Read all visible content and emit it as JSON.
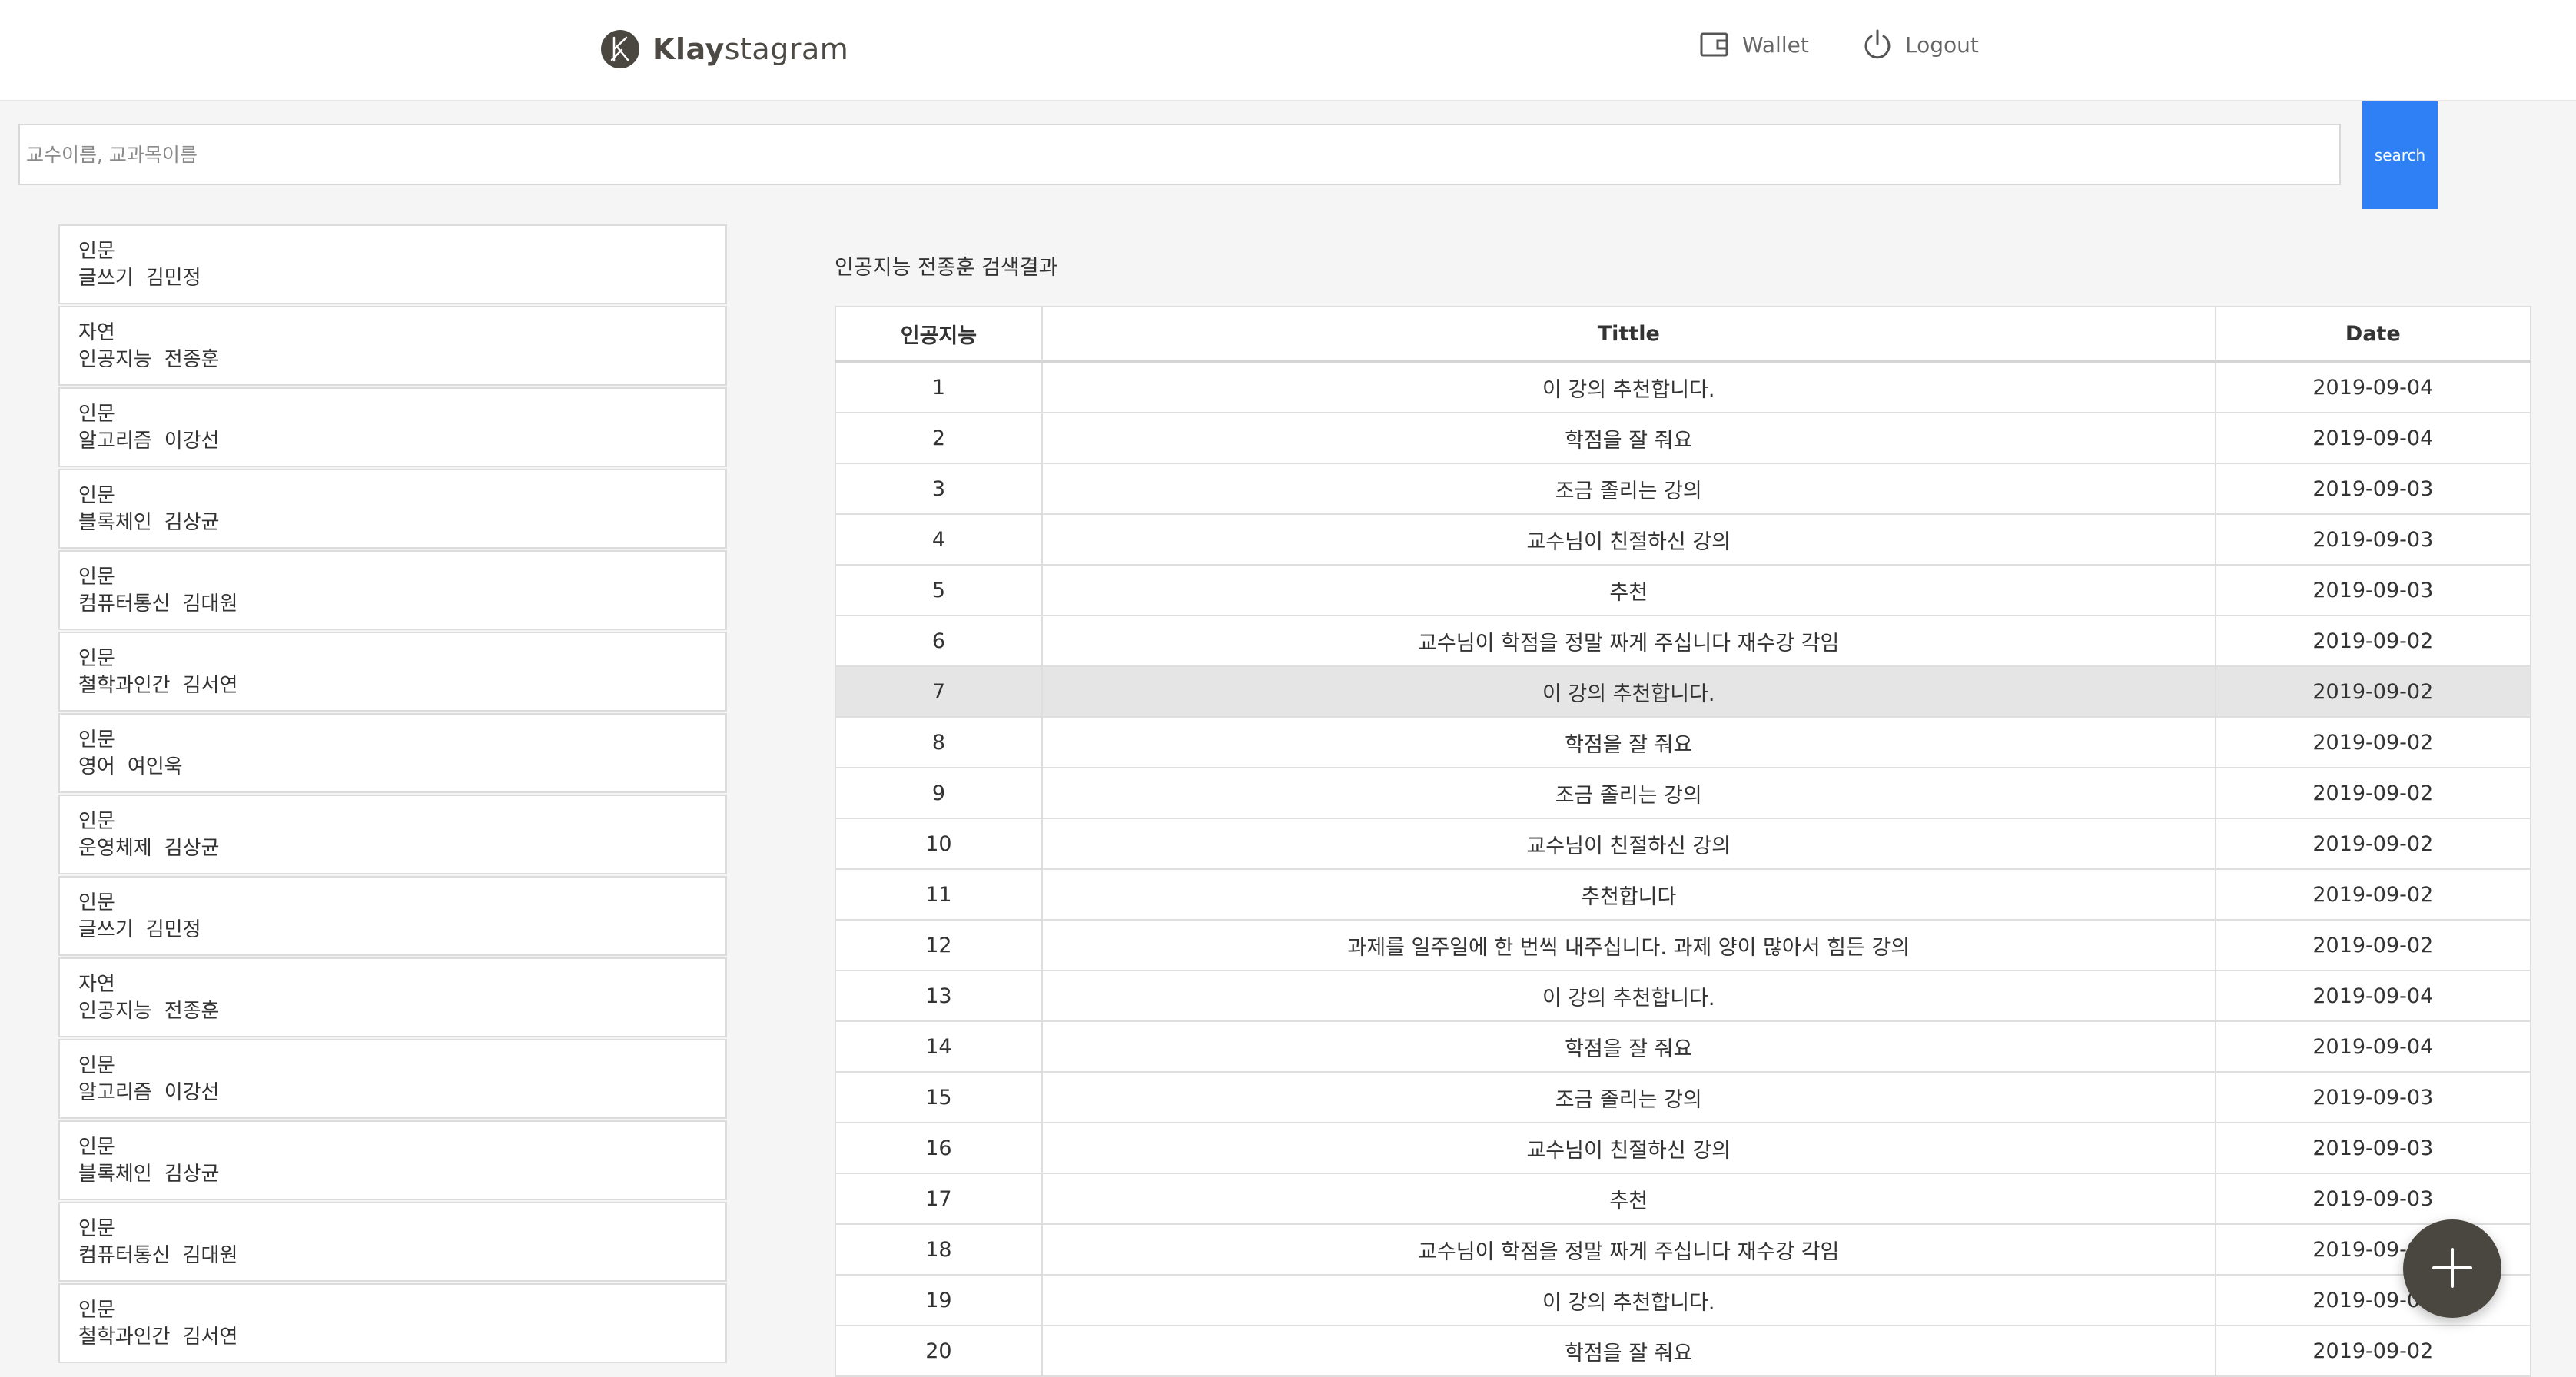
{
  "header": {
    "logo_bold": "Klay",
    "logo_rest": "stagram",
    "wallet_label": "Wallet",
    "logout_label": "Logout"
  },
  "search": {
    "placeholder": "교수이름, 교과목이름",
    "value": "",
    "button_label": "search"
  },
  "courses": [
    {
      "category": "인문",
      "course": "글쓰기",
      "professor": "김민정"
    },
    {
      "category": "자연",
      "course": "인공지능",
      "professor": "전종훈"
    },
    {
      "category": "인문",
      "course": "알고리즘",
      "professor": "이강선"
    },
    {
      "category": "인문",
      "course": "블록체인",
      "professor": "김상균"
    },
    {
      "category": "인문",
      "course": "컴퓨터통신",
      "professor": "김대원"
    },
    {
      "category": "인문",
      "course": "철학과인간",
      "professor": "김서연"
    },
    {
      "category": "인문",
      "course": "영어",
      "professor": "여인욱"
    },
    {
      "category": "인문",
      "course": "운영체제",
      "professor": "김상균"
    },
    {
      "category": "인문",
      "course": "글쓰기",
      "professor": "김민정"
    },
    {
      "category": "자연",
      "course": "인공지능",
      "professor": "전종훈"
    },
    {
      "category": "인문",
      "course": "알고리즘",
      "professor": "이강선"
    },
    {
      "category": "인문",
      "course": "블록체인",
      "professor": "김상균"
    },
    {
      "category": "인문",
      "course": "컴퓨터통신",
      "professor": "김대원"
    },
    {
      "category": "인문",
      "course": "철학과인간",
      "professor": "김서연"
    }
  ],
  "results": {
    "title": "인공지능 전종훈 검색결과",
    "headers": {
      "no": "인공지능",
      "title": "Tittle",
      "date": "Date"
    },
    "highlighted_row": 7,
    "rows": [
      {
        "no": "1",
        "title": "이 강의 추천합니다.",
        "date": "2019-09-04"
      },
      {
        "no": "2",
        "title": "학점을 잘 줘요",
        "date": "2019-09-04"
      },
      {
        "no": "3",
        "title": "조금 졸리는 강의",
        "date": "2019-09-03"
      },
      {
        "no": "4",
        "title": "교수님이 친절하신 강의",
        "date": "2019-09-03"
      },
      {
        "no": "5",
        "title": "추천",
        "date": "2019-09-03"
      },
      {
        "no": "6",
        "title": "교수님이 학점을 정말 짜게 주십니다 재수강 각임",
        "date": "2019-09-02"
      },
      {
        "no": "7",
        "title": "이 강의 추천합니다.",
        "date": "2019-09-02"
      },
      {
        "no": "8",
        "title": "학점을 잘 줘요",
        "date": "2019-09-02"
      },
      {
        "no": "9",
        "title": "조금 졸리는 강의",
        "date": "2019-09-02"
      },
      {
        "no": "10",
        "title": "교수님이 친절하신 강의",
        "date": "2019-09-02"
      },
      {
        "no": "11",
        "title": "추천합니다",
        "date": "2019-09-02"
      },
      {
        "no": "12",
        "title": "과제를 일주일에 한 번씩 내주십니다. 과제 양이 많아서 힘든 강의",
        "date": "2019-09-02"
      },
      {
        "no": "13",
        "title": "이 강의 추천합니다.",
        "date": "2019-09-04"
      },
      {
        "no": "14",
        "title": "학점을 잘 줘요",
        "date": "2019-09-04"
      },
      {
        "no": "15",
        "title": "조금 졸리는 강의",
        "date": "2019-09-03"
      },
      {
        "no": "16",
        "title": "교수님이 친절하신 강의",
        "date": "2019-09-03"
      },
      {
        "no": "17",
        "title": "추천",
        "date": "2019-09-03"
      },
      {
        "no": "18",
        "title": "교수님이 학점을 정말 짜게 주십니다 재수강 각임",
        "date": "2019-09-02"
      },
      {
        "no": "19",
        "title": "이 강의 추천합니다.",
        "date": "2019-09-02"
      },
      {
        "no": "20",
        "title": "학점을 잘 줘요",
        "date": "2019-09-02"
      }
    ]
  },
  "icons": {
    "logo": "klaytn-logo-icon",
    "wallet": "wallet-icon",
    "logout": "power-icon",
    "fab": "plus-icon"
  },
  "colors": {
    "primary": "#2f80f5",
    "fab": "#4a4640",
    "highlight_row": "#e5e5e5"
  }
}
